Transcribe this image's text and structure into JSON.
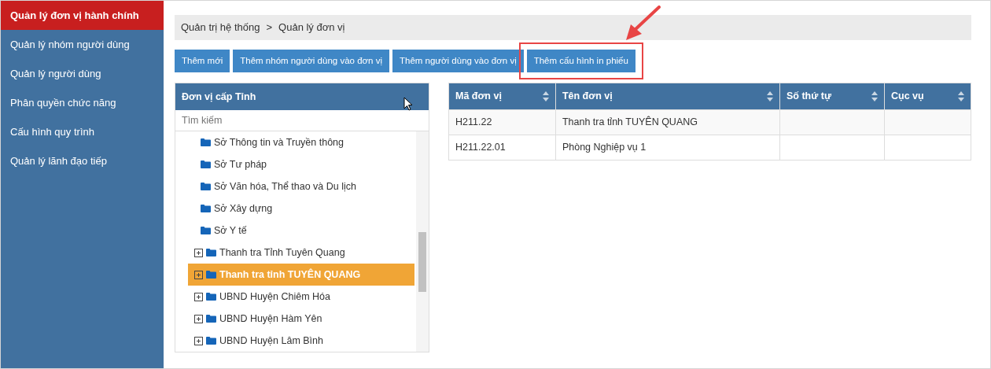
{
  "sidebar": {
    "items": [
      {
        "label": "Quản lý đơn vị hành chính",
        "selected": true
      },
      {
        "label": "Quản lý nhóm người dùng",
        "selected": false
      },
      {
        "label": "Quản lý người dùng",
        "selected": false
      },
      {
        "label": "Phân quyền chức năng",
        "selected": false
      },
      {
        "label": "Cấu hình quy trình",
        "selected": false
      },
      {
        "label": "Quản lý lãnh đạo tiếp",
        "selected": false
      }
    ]
  },
  "breadcrumb": [
    "Quản trị hệ thống",
    "Quản lý đơn vị"
  ],
  "breadcrumb_separator": ">",
  "toolbar": [
    {
      "label": "Thêm mới",
      "highlighted": false
    },
    {
      "label": "Thêm nhóm người dùng vào đơn vị",
      "highlighted": false
    },
    {
      "label": "Thêm người dùng vào đơn vị",
      "highlighted": false
    },
    {
      "label": "Thêm cấu hình in phiếu",
      "highlighted": true
    }
  ],
  "tree_panel": {
    "title": "Đơn vị cấp Tỉnh",
    "search": {
      "placeholder": "Tìm kiếm"
    },
    "items": [
      {
        "label": "Sở Thông tin và Truyền thông",
        "kind": "leaf",
        "selected": false
      },
      {
        "label": "Sở Tư pháp",
        "kind": "leaf",
        "selected": false
      },
      {
        "label": "Sở Văn hóa, Thể thao và Du lịch",
        "kind": "leaf",
        "selected": false
      },
      {
        "label": "Sở Xây dựng",
        "kind": "leaf",
        "selected": false
      },
      {
        "label": "Sở Y tế",
        "kind": "leaf",
        "selected": false
      },
      {
        "label": "Thanh tra Tỉnh Tuyên Quang",
        "kind": "collapsed",
        "selected": false
      },
      {
        "label": "Thanh tra tỉnh TUYÊN QUANG",
        "kind": "collapsed",
        "selected": true
      },
      {
        "label": "UBND Huyện Chiêm Hóa",
        "kind": "collapsed",
        "selected": false
      },
      {
        "label": "UBND Huyện Hàm Yên",
        "kind": "collapsed",
        "selected": false
      },
      {
        "label": "UBND Huyện Lâm Bình",
        "kind": "collapsed",
        "selected": false
      }
    ]
  },
  "table": {
    "columns": [
      "Mã đơn vị",
      "Tên đơn vị",
      "Số thứ tự",
      "Cục vụ"
    ],
    "rows": [
      [
        "H211.22",
        "Thanh tra tỉnh TUYÊN QUANG",
        "",
        ""
      ],
      [
        "H211.22.01",
        "Phòng Nghiệp vụ 1",
        "",
        ""
      ]
    ]
  }
}
